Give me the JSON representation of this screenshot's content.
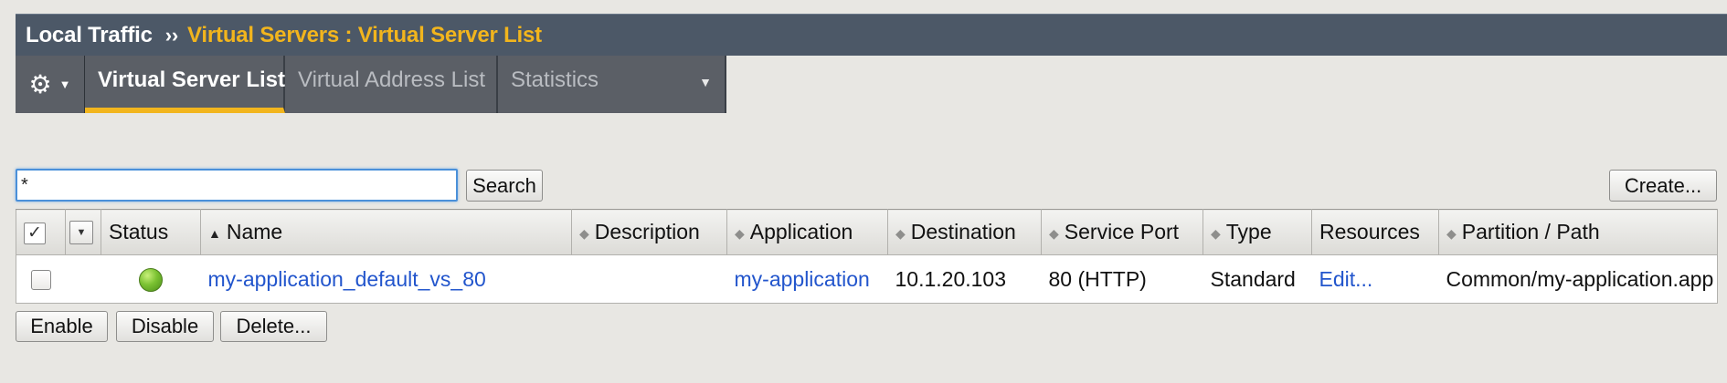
{
  "breadcrumb": {
    "section": "Local Traffic",
    "separator": "››",
    "page": "Virtual Servers : Virtual Server List"
  },
  "tabs": [
    {
      "label": "Virtual Server List",
      "active": true
    },
    {
      "label": "Virtual Address List",
      "active": false
    },
    {
      "label": "Statistics",
      "active": false
    }
  ],
  "search": {
    "value": "*",
    "button_label": "Search"
  },
  "create_label": "Create...",
  "table": {
    "headers": {
      "status": "Status",
      "name": "Name",
      "description": "Description",
      "application": "Application",
      "destination": "Destination",
      "service_port": "Service Port",
      "type": "Type",
      "resources": "Resources",
      "partition": "Partition / Path"
    },
    "rows": [
      {
        "status": "available",
        "name": "my-application_default_vs_80",
        "description": "",
        "application": "my-application",
        "destination": "10.1.20.103",
        "service_port": "80 (HTTP)",
        "type": "Standard",
        "resources": "Edit...",
        "partition": "Common/my-application.app"
      }
    ]
  },
  "actions": {
    "enable": "Enable",
    "disable": "Disable",
    "delete": "Delete..."
  },
  "colors": {
    "accent": "#f2b51d",
    "titlebar": "#4c5867",
    "link": "#2255cc",
    "status_available": "#7bc232"
  }
}
